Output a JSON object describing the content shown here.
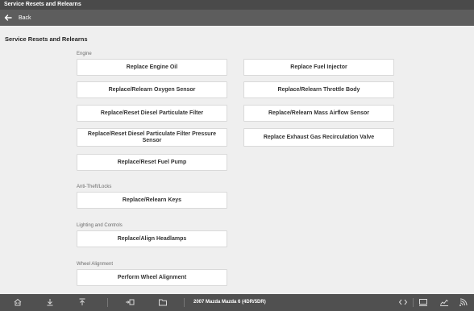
{
  "window": {
    "title": "Service Resets and Relearns"
  },
  "nav": {
    "back_label": "Back"
  },
  "page": {
    "title": "Service Resets and Relearns"
  },
  "sections": {
    "engine": {
      "label": "Engine",
      "left": [
        "Replace Engine Oil",
        "Replace/Relearn Oxygen Sensor",
        "Replace/Reset Diesel Particulate Filter",
        "Replace/Reset Diesel Particulate Filter Pressure Sensor",
        "Replace/Reset Fuel Pump"
      ],
      "right": [
        "Replace Fuel Injector",
        "Replace/Relearn Throttle Body",
        "Replace/Relearn Mass Airflow Sensor",
        "Replace Exhaust Gas Recirculation Valve"
      ]
    },
    "anti_theft": {
      "label": "Anti-Theft/Locks",
      "items": [
        "Replace/Relearn Keys"
      ]
    },
    "lighting": {
      "label": "Lighting and Controls",
      "items": [
        "Replace/Align Headlamps"
      ]
    },
    "alignment": {
      "label": "Wheel Alignment",
      "items": [
        "Perform Wheel Alignment"
      ]
    }
  },
  "bottombar": {
    "vehicle": "2007 Mazda Mazda 6 (4DR/5DR)",
    "icons": [
      "home-icon",
      "download-icon",
      "upload-icon",
      "vehicle-connect-icon",
      "folder-icon",
      "code-icon",
      "monitor-icon",
      "chart-icon",
      "wireless-icon"
    ]
  },
  "colors": {
    "titlebar": "#4a4a4a",
    "navbar": "#5d5d5d",
    "background": "#efefef",
    "bottombar": "#505050"
  }
}
